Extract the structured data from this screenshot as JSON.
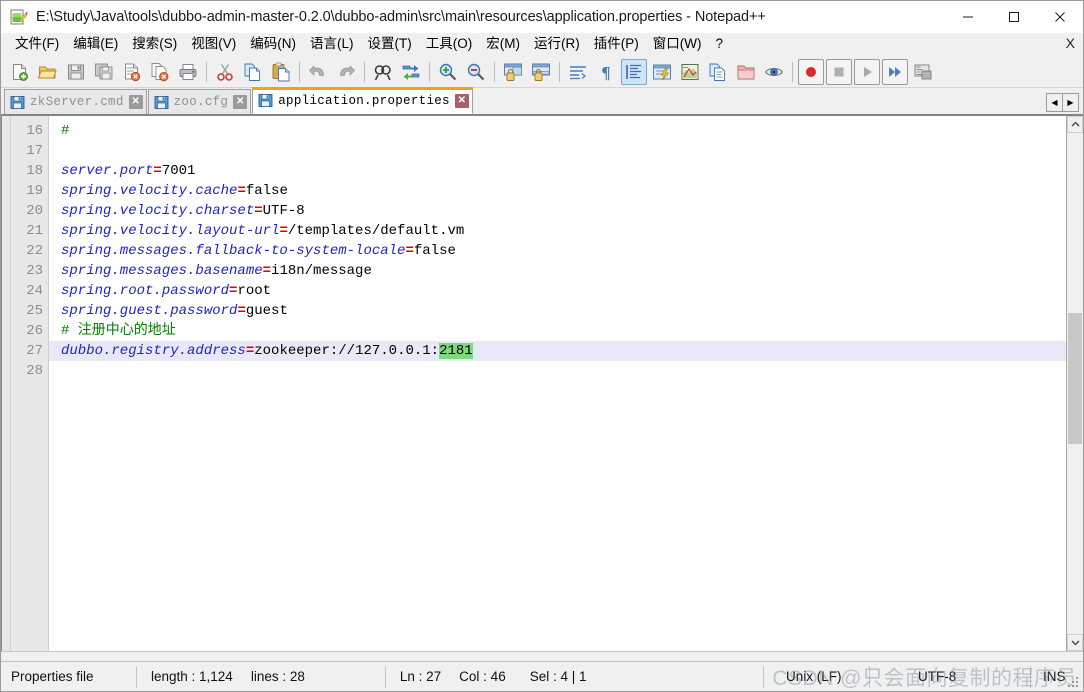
{
  "window": {
    "title": "E:\\Study\\Java\\tools\\dubbo-admin-master-0.2.0\\dubbo-admin\\src\\main\\resources\\application.properties - Notepad++",
    "icon": "notepad-plus-plus-icon",
    "minimize_label": "—",
    "maximize_label": "☐",
    "close_label": "✕"
  },
  "menu": {
    "items": [
      {
        "label": "文件(F)",
        "name": "menu-file"
      },
      {
        "label": "编辑(E)",
        "name": "menu-edit"
      },
      {
        "label": "搜索(S)",
        "name": "menu-search"
      },
      {
        "label": "视图(V)",
        "name": "menu-view"
      },
      {
        "label": "编码(N)",
        "name": "menu-encoding"
      },
      {
        "label": "语言(L)",
        "name": "menu-language"
      },
      {
        "label": "设置(T)",
        "name": "menu-settings"
      },
      {
        "label": "工具(O)",
        "name": "menu-tools"
      },
      {
        "label": "宏(M)",
        "name": "menu-macro"
      },
      {
        "label": "运行(R)",
        "name": "menu-run"
      },
      {
        "label": "插件(P)",
        "name": "menu-plugins"
      },
      {
        "label": "窗口(W)",
        "name": "menu-window"
      },
      {
        "label": "?",
        "name": "menu-help"
      }
    ],
    "close_document_label": "X"
  },
  "toolbar": {
    "buttons": [
      {
        "name": "new-file-icon",
        "glyph": "new"
      },
      {
        "name": "open-file-icon",
        "glyph": "open"
      },
      {
        "name": "save-icon",
        "glyph": "save"
      },
      {
        "name": "save-all-icon",
        "glyph": "saveall"
      },
      {
        "name": "close-file-icon",
        "glyph": "close"
      },
      {
        "name": "close-all-files-icon",
        "glyph": "closeall"
      },
      {
        "name": "print-icon",
        "glyph": "print"
      },
      {
        "name": "separator-1",
        "glyph": "sep"
      },
      {
        "name": "cut-icon",
        "glyph": "cut"
      },
      {
        "name": "copy-icon",
        "glyph": "copy"
      },
      {
        "name": "paste-icon",
        "glyph": "paste"
      },
      {
        "name": "separator-2",
        "glyph": "sep"
      },
      {
        "name": "undo-icon",
        "glyph": "undo"
      },
      {
        "name": "redo-icon",
        "glyph": "redo"
      },
      {
        "name": "separator-3",
        "glyph": "sep"
      },
      {
        "name": "find-icon",
        "glyph": "find"
      },
      {
        "name": "replace-icon",
        "glyph": "replace"
      },
      {
        "name": "separator-4",
        "glyph": "sep"
      },
      {
        "name": "zoom-in-icon",
        "glyph": "zoomin"
      },
      {
        "name": "zoom-out-icon",
        "glyph": "zoomout"
      },
      {
        "name": "separator-5",
        "glyph": "sep"
      },
      {
        "name": "sync-vertical-scroll-icon",
        "glyph": "syncv"
      },
      {
        "name": "sync-horizontal-scroll-icon",
        "glyph": "synch"
      },
      {
        "name": "separator-6",
        "glyph": "sep"
      },
      {
        "name": "word-wrap-icon",
        "glyph": "wrap"
      },
      {
        "name": "show-all-characters-icon",
        "glyph": "pilcrow"
      },
      {
        "name": "show-indent-guide-icon",
        "glyph": "indent",
        "active": true
      },
      {
        "name": "user-defined-dialog-icon",
        "glyph": "udl"
      },
      {
        "name": "document-map-icon",
        "glyph": "map"
      },
      {
        "name": "function-list-icon",
        "glyph": "funclist"
      },
      {
        "name": "document-list-icon",
        "glyph": "doclist"
      },
      {
        "name": "folder-as-workspace-icon",
        "glyph": "folderws"
      },
      {
        "name": "monitoring-icon",
        "glyph": "eye"
      },
      {
        "name": "separator-7",
        "glyph": "sep"
      },
      {
        "name": "record-macro-icon",
        "glyph": "record"
      },
      {
        "name": "stop-macro-icon",
        "glyph": "stop"
      },
      {
        "name": "play-macro-icon",
        "glyph": "play"
      },
      {
        "name": "run-macro-multiple-icon",
        "glyph": "playmulti"
      },
      {
        "name": "run-icon",
        "glyph": "run"
      }
    ]
  },
  "tabs": {
    "items": [
      {
        "label": "zkServer.cmd",
        "active": false,
        "name": "tab-zkserver-cmd"
      },
      {
        "label": "zoo.cfg",
        "active": false,
        "name": "tab-zoo-cfg"
      },
      {
        "label": "application.properties",
        "active": true,
        "name": "tab-application-properties"
      }
    ],
    "close_glyph": "✕",
    "scroll_left_glyph": "◀",
    "scroll_right_glyph": "▶"
  },
  "editor": {
    "first_line": 16,
    "lines": [
      {
        "n": 16,
        "tokens": [
          {
            "t": "comment",
            "s": "#"
          }
        ]
      },
      {
        "n": 17,
        "tokens": []
      },
      {
        "n": 18,
        "tokens": [
          {
            "t": "key",
            "s": "server.port"
          },
          {
            "t": "eq",
            "s": "="
          },
          {
            "t": "val",
            "s": "7001"
          }
        ]
      },
      {
        "n": 19,
        "tokens": [
          {
            "t": "key",
            "s": "spring.velocity.cache"
          },
          {
            "t": "eq",
            "s": "="
          },
          {
            "t": "val",
            "s": "false"
          }
        ]
      },
      {
        "n": 20,
        "tokens": [
          {
            "t": "key",
            "s": "spring.velocity.charset"
          },
          {
            "t": "eq",
            "s": "="
          },
          {
            "t": "val",
            "s": "UTF-8"
          }
        ]
      },
      {
        "n": 21,
        "tokens": [
          {
            "t": "key",
            "s": "spring.velocity.layout-url"
          },
          {
            "t": "eq",
            "s": "="
          },
          {
            "t": "val",
            "s": "/templates/default.vm"
          }
        ]
      },
      {
        "n": 22,
        "tokens": [
          {
            "t": "key",
            "s": "spring.messages.fallback-to-system-locale"
          },
          {
            "t": "eq",
            "s": "="
          },
          {
            "t": "val",
            "s": "false"
          }
        ]
      },
      {
        "n": 23,
        "tokens": [
          {
            "t": "key",
            "s": "spring.messages.basename"
          },
          {
            "t": "eq",
            "s": "="
          },
          {
            "t": "val",
            "s": "i18n/message"
          }
        ]
      },
      {
        "n": 24,
        "tokens": [
          {
            "t": "key",
            "s": "spring.root.password"
          },
          {
            "t": "eq",
            "s": "="
          },
          {
            "t": "val",
            "s": "root"
          }
        ]
      },
      {
        "n": 25,
        "tokens": [
          {
            "t": "key",
            "s": "spring.guest.password"
          },
          {
            "t": "eq",
            "s": "="
          },
          {
            "t": "val",
            "s": "guest"
          }
        ]
      },
      {
        "n": 26,
        "tokens": [
          {
            "t": "comment",
            "s": "# 注册中心的地址"
          }
        ]
      },
      {
        "n": 27,
        "current": true,
        "tokens": [
          {
            "t": "key",
            "s": "dubbo.registry.address"
          },
          {
            "t": "eq",
            "s": "="
          },
          {
            "t": "val",
            "s": "zookeeper://127.0.0.1:"
          },
          {
            "t": "sel",
            "s": "2181"
          }
        ]
      },
      {
        "n": 28,
        "tokens": []
      }
    ]
  },
  "statusbar": {
    "file_type": "Properties file",
    "length": "length : 1,124",
    "lines": "lines : 28",
    "ln": "Ln : 27",
    "col": "Col : 46",
    "sel": "Sel : 4 | 1",
    "eol": "Unix (LF)",
    "encoding": "UTF-8",
    "insert_mode": "INS"
  },
  "watermark": {
    "text": "CSDN @只会面向复制的程序员"
  },
  "colors": {
    "active_tab_top": "#f0a21a",
    "selection": "#7ed97e",
    "current_line": "#e8e8f8",
    "key": "#2222cc",
    "equals": "#e00000",
    "comment": "#008000"
  }
}
